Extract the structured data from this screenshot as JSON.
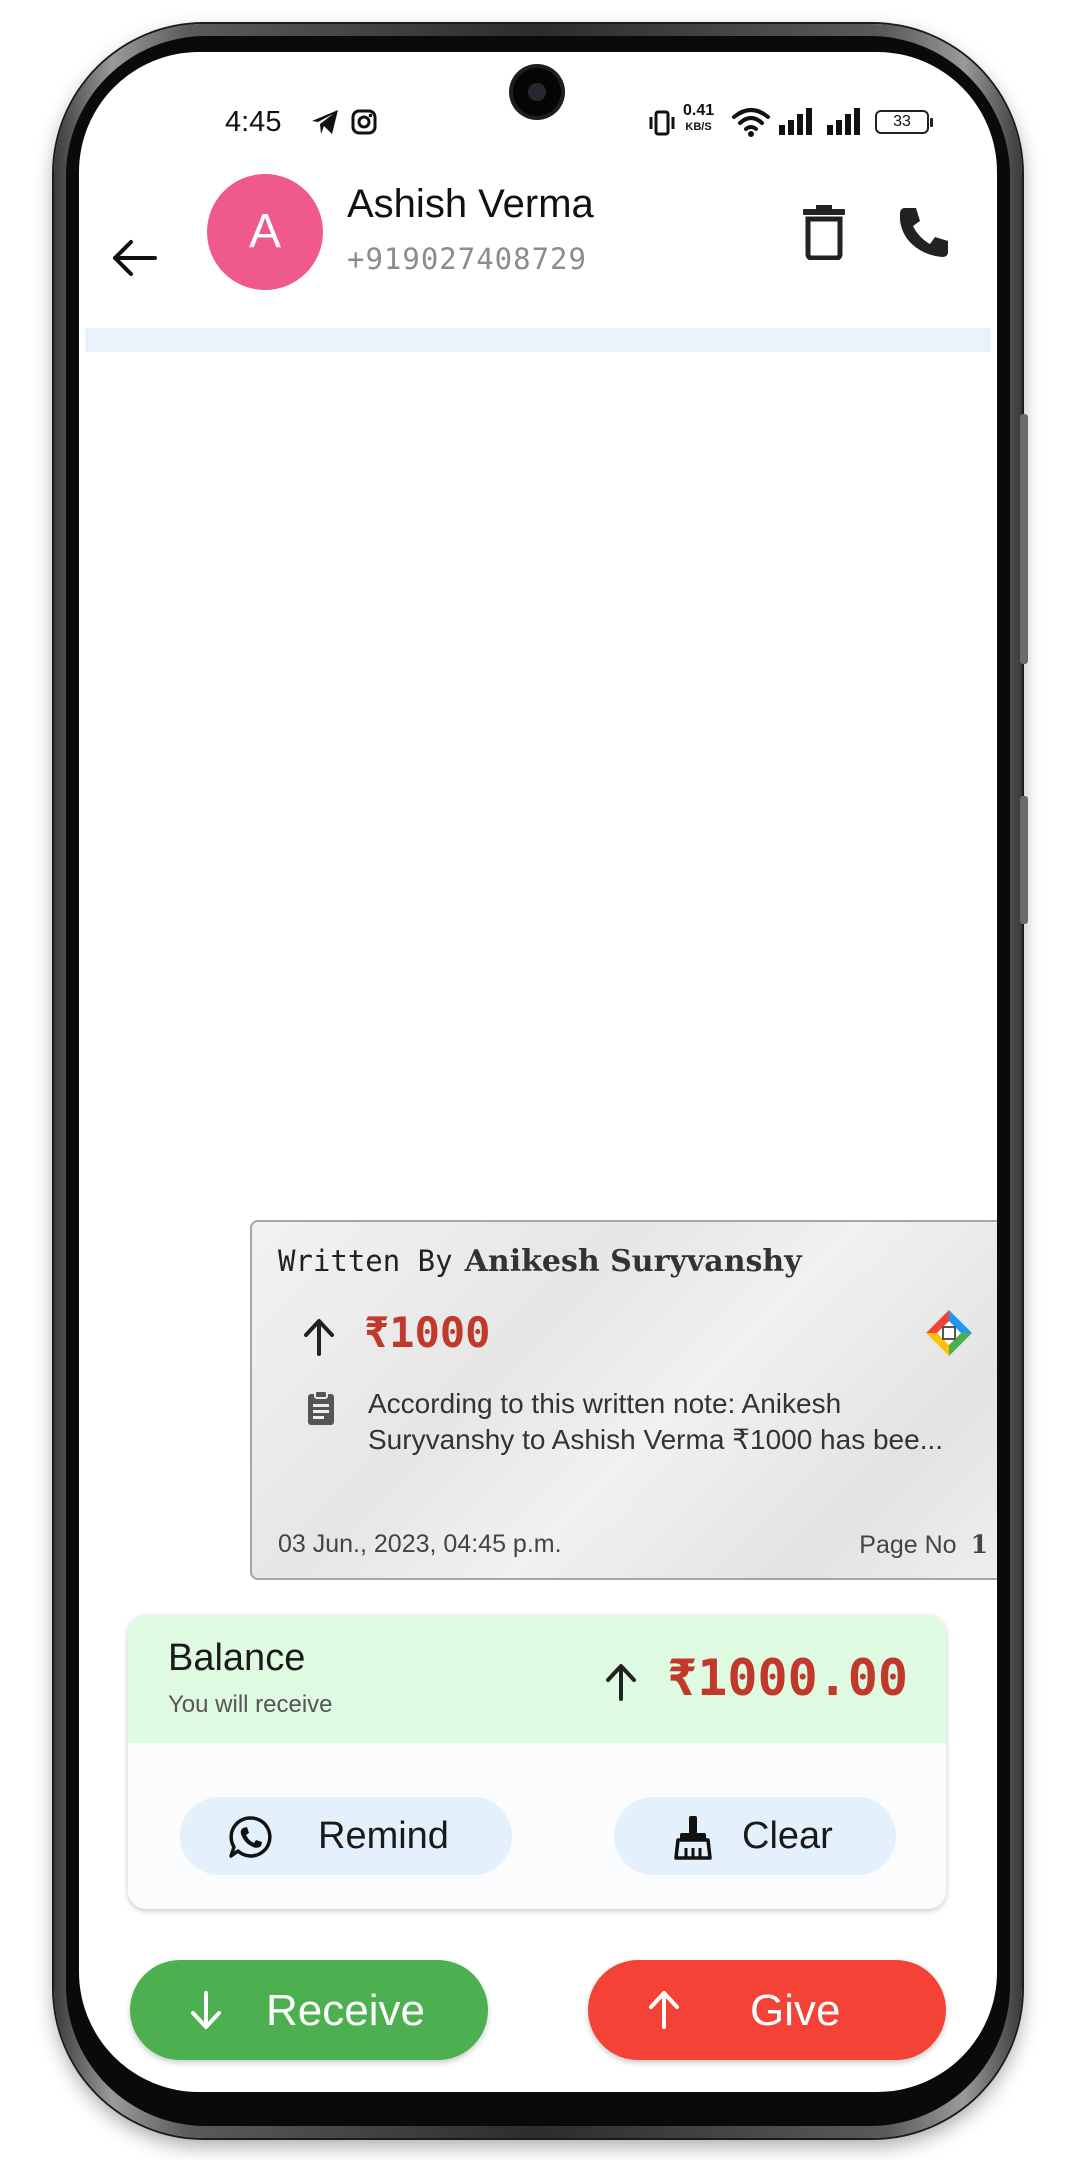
{
  "status_bar": {
    "time": "4:45",
    "net_speed": "0.41",
    "net_unit": "KB/S",
    "battery": "33"
  },
  "header": {
    "avatar_letter": "A",
    "contact_name": "Ashish Verma",
    "contact_phone": "+919027408729",
    "avatar_color": "#ef5a8b"
  },
  "transaction": {
    "written_by_label": "Written By",
    "author": "Anikesh Suryvanshy",
    "amount": "₹1000",
    "note": "According to this written note: Anikesh Suryvanshy to Ashish Verma ₹1000 has bee...",
    "date": "03 Jun., 2023, 04:45 p.m.",
    "page_label": "Page No",
    "page_number": "1",
    "amount_color": "#c0392b"
  },
  "balance": {
    "label": "Balance",
    "sublabel": "You will receive",
    "amount": "₹1000.00",
    "remind_label": "Remind",
    "clear_label": "Clear",
    "top_color": "#defbe1"
  },
  "actions": {
    "receive_label": "Receive",
    "give_label": "Give",
    "receive_color": "#4caf50",
    "give_color": "#f44336"
  },
  "icons": {
    "status": [
      "telegram-icon",
      "instagram-icon",
      "vibrate-icon",
      "wifi-icon",
      "signal-icon",
      "battery-icon"
    ],
    "header": [
      "back-arrow-icon",
      "delete-icon",
      "phone-call-icon"
    ],
    "balance": [
      "whatsapp-icon",
      "broom-icon"
    ]
  }
}
